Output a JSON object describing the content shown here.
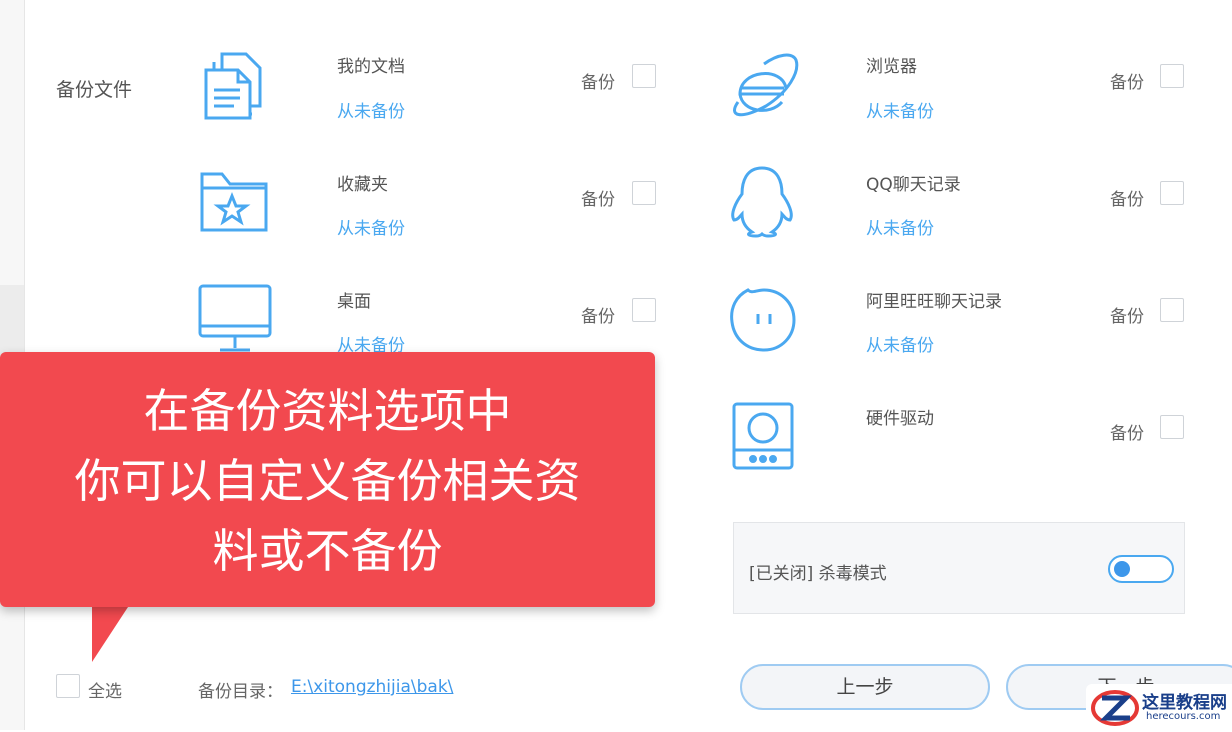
{
  "section_label": "备份文件",
  "items": [
    {
      "name": "我的文档",
      "status": "从未备份",
      "backup_label": "备份",
      "icon": "documents-icon"
    },
    {
      "name": "浏览器",
      "status": "从未备份",
      "backup_label": "备份",
      "icon": "browser-icon"
    },
    {
      "name": "收藏夹",
      "status": "从未备份",
      "backup_label": "备份",
      "icon": "favorites-folder-icon"
    },
    {
      "name": "QQ聊天记录",
      "status": "从未备份",
      "backup_label": "备份",
      "icon": "qq-penguin-icon"
    },
    {
      "name": "桌面",
      "status": "从未备份",
      "backup_label": "备份",
      "icon": "desktop-monitor-icon"
    },
    {
      "name": "阿里旺旺聊天记录",
      "status": "从未备份",
      "backup_label": "备份",
      "icon": "aliwangwang-icon"
    },
    {
      "name": "硬件驱动",
      "status": "",
      "backup_label": "备份",
      "icon": "hardware-driver-icon"
    }
  ],
  "antivirus": {
    "text": "[已关闭] 杀毒模式"
  },
  "select_all": "全选",
  "backup_dir": {
    "label": "备份目录：",
    "path": "E:\\xitongzhijia\\bak\\"
  },
  "buttons": {
    "prev": "上一步",
    "next": "下一步"
  },
  "callout": {
    "line1": "在备份资料选项中",
    "line2": "你可以自定义备份相关资",
    "line3": "料或不备份"
  },
  "watermark": {
    "title": "这里教程网",
    "url": "herecours.com"
  },
  "colors": {
    "accent": "#4aa8f0",
    "callout": "#f2494f"
  }
}
